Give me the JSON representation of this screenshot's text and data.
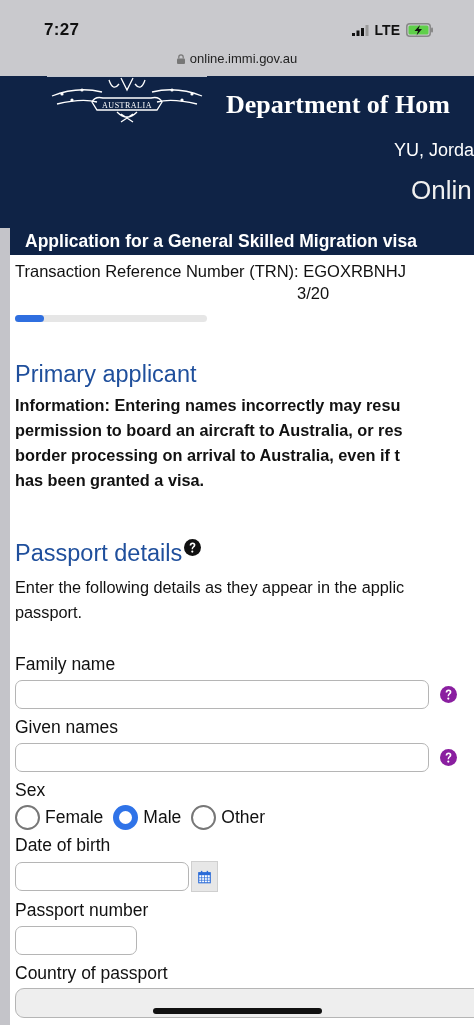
{
  "status_bar": {
    "time": "7:27",
    "network": "LTE"
  },
  "browser": {
    "url": "online.immi.gov.au"
  },
  "header": {
    "crest_text": "AUSTRALIA",
    "department": "Department of Hom",
    "user": "YU, Jorda",
    "service": "Onlin"
  },
  "title_bar": {
    "title": "Application for a General Skilled Migration visa"
  },
  "trn": {
    "label": "Transaction Reference Number (TRN): EGOXRBNHJ",
    "step": "3/20",
    "level": 0.15
  },
  "primary_applicant": {
    "heading": "Primary applicant",
    "information": "Information: Entering names incorrectly may resu\npermission to board an aircraft to Australia, or res\nborder processing on arrival to Australia, even if t\nhas been granted a visa."
  },
  "passport_details": {
    "heading": "Passport details",
    "intro": "Enter the following details as they appear in the applic\npassport.",
    "fields": [
      {
        "kind": "wide_text",
        "label": "Family name",
        "help": true
      },
      {
        "kind": "wide_text",
        "label": "Given names",
        "help": true
      },
      {
        "kind": "radio",
        "label": "Sex",
        "options": [
          {
            "label": "Female",
            "selected": false
          },
          {
            "label": "Male",
            "selected": true
          },
          {
            "label": "Other",
            "selected": false
          }
        ]
      },
      {
        "kind": "date",
        "label": "Date of birth"
      },
      {
        "kind": "short_text",
        "label": "Passport number",
        "help": false
      },
      {
        "kind": "select",
        "label": "Country of passport"
      }
    ]
  }
}
